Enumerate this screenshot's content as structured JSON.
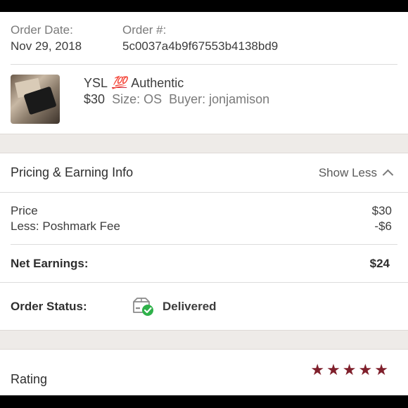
{
  "order": {
    "date_label": "Order Date:",
    "date_value": "Nov 29, 2018",
    "number_label": "Order #:",
    "number_value": "5c0037a4b9f67553b4138bd9"
  },
  "item": {
    "brand": "YSL",
    "emoji": "💯",
    "title_suffix": "Authentic",
    "price": "$30",
    "size": "Size: OS",
    "buyer": "Buyer: jonjamison"
  },
  "pricing": {
    "title": "Pricing & Earning Info",
    "toggle_label": "Show Less",
    "rows": [
      {
        "label": "Price",
        "value": "$30"
      },
      {
        "label": "Less: Poshmark Fee",
        "value": "-$6"
      }
    ],
    "net_label": "Net Earnings:",
    "net_value": "$24"
  },
  "status": {
    "label": "Order Status:",
    "value": "Delivered"
  },
  "rating": {
    "label": "Rating",
    "stars": 5
  },
  "colors": {
    "accent": "#7f1f2b",
    "delivered_check": "#2fb14a"
  }
}
